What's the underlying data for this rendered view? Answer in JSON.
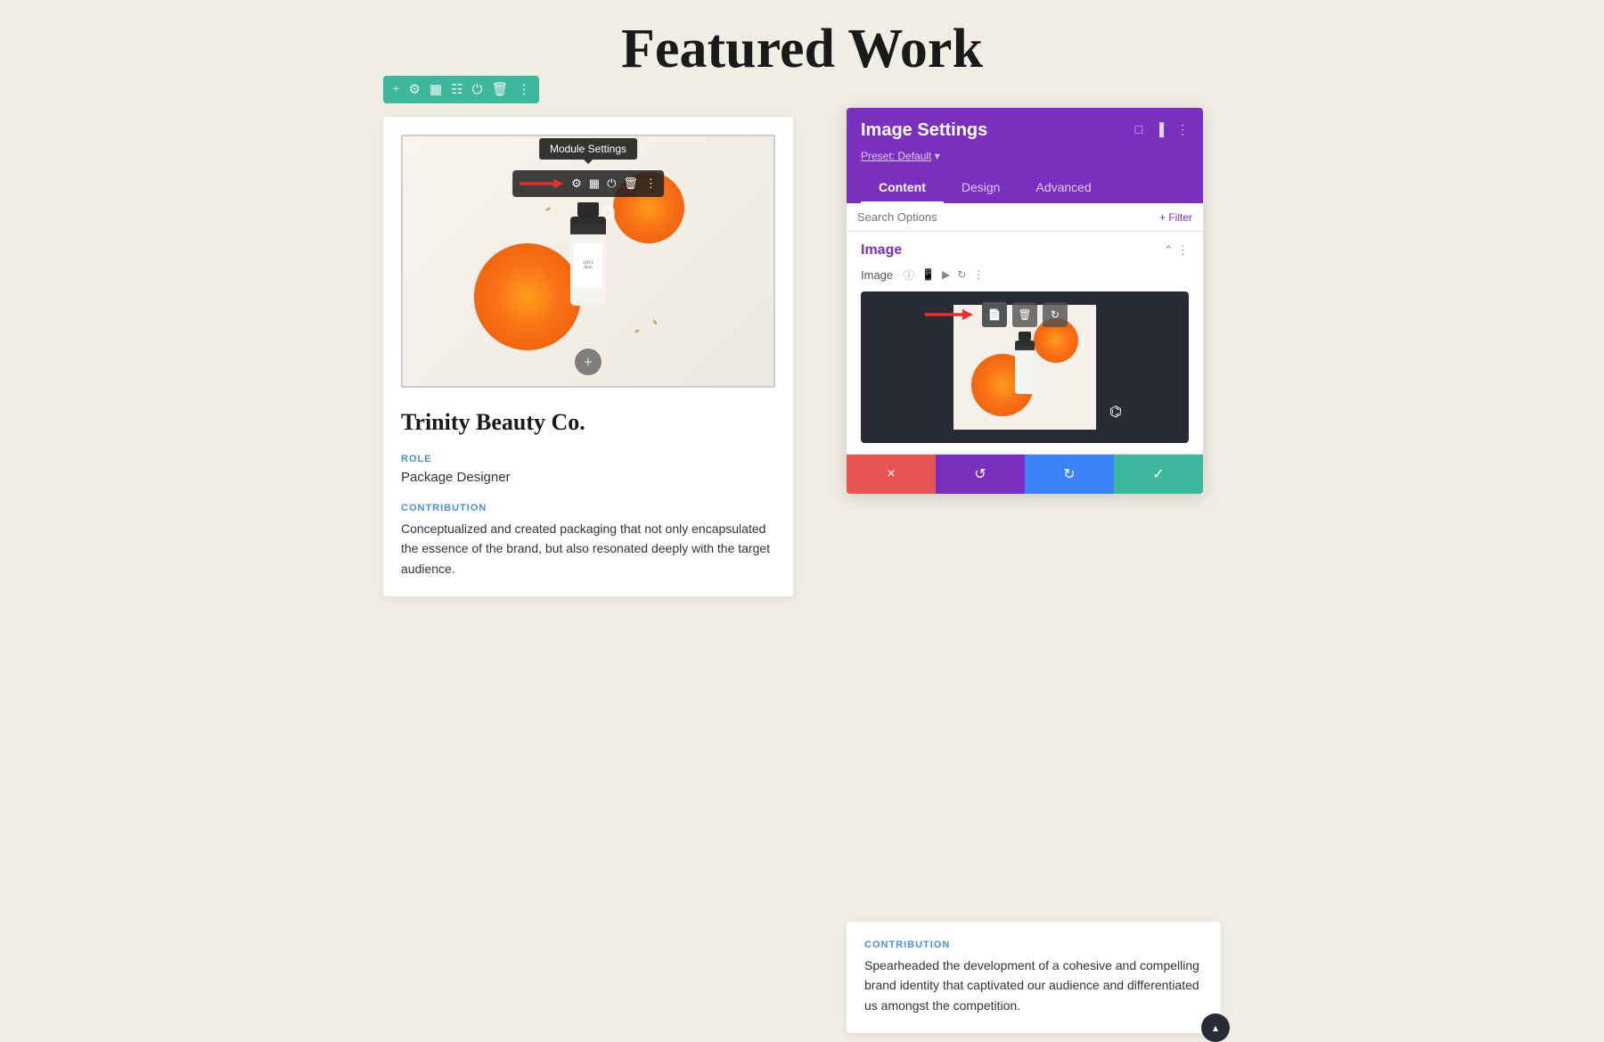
{
  "page": {
    "title": "Featured Work",
    "background": "#f0ede4"
  },
  "module_toolbar": {
    "icons": [
      "plus-icon",
      "gear-icon",
      "copy-icon",
      "grid-icon",
      "power-icon",
      "trash-icon",
      "dots-icon"
    ]
  },
  "left_card": {
    "title": "Trinity Beauty Co.",
    "role_label": "ROLE",
    "role_value": "Package Designer",
    "contribution_label": "CONTRIBUTION",
    "contribution_text": "Conceptualized and created packaging that not only encapsulated the essence of the brand, but also resonated deeply with the target audience."
  },
  "image_overlay": {
    "tooltip": "Module Settings",
    "icons": [
      "gear-icon",
      "copy-icon",
      "power-icon",
      "trash-icon",
      "dots-icon"
    ]
  },
  "settings_panel": {
    "title": "Image Settings",
    "preset_label": "Preset: Default",
    "tabs": [
      "Content",
      "Design",
      "Advanced"
    ],
    "active_tab": "Content",
    "search_placeholder": "Search Options",
    "filter_label": "+ Filter",
    "image_section_title": "Image",
    "image_field_label": "Image",
    "header_icons": [
      "fullscreen-icon",
      "split-icon",
      "dots-icon"
    ]
  },
  "action_buttons": {
    "cancel": "×",
    "undo": "↺",
    "redo": "↻",
    "confirm": "✓"
  },
  "right_card": {
    "contribution_label": "CONTRIBUTION",
    "contribution_text": "Spearheaded the development of a cohesive and compelling brand identity that captivated our audience and differentiated us amongst the competition."
  }
}
